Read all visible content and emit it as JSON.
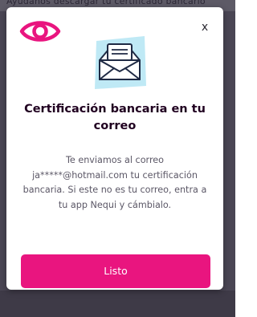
{
  "background": {
    "obscured_text": "Ayúdanos descargar tu certificado bancario"
  },
  "modal": {
    "close_label": "x",
    "title": "Certificación bancaria en tu correo",
    "body": "Te enviamos al correo ja*****@hotmail.com tu certificación bancaria. Si este no es tu correo, entra a tu app Nequi y cámbialo.",
    "confirm_label": "Listo"
  },
  "icons": {
    "top_left": "eye-icon",
    "illustration": "open-envelope-icon",
    "close": "close-icon"
  },
  "colors": {
    "accent": "#e9157f",
    "title": "#200020",
    "body": "#5b5766",
    "illustration_bg": "#bfe9f5",
    "overlay": "#4a4654"
  }
}
